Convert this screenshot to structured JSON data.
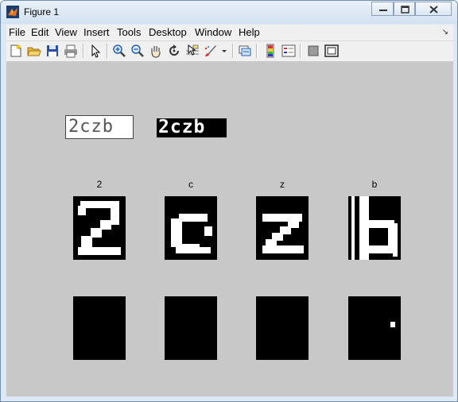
{
  "window": {
    "title": "Figure 1"
  },
  "menu": [
    "File",
    "Edit",
    "View",
    "Insert",
    "Tools",
    "Desktop",
    "Window",
    "Help"
  ],
  "toolbar": [
    "new-figure-icon",
    "open-icon",
    "save-icon",
    "print-icon",
    "pointer-icon",
    "zoom-in-icon",
    "zoom-out-icon",
    "pan-icon",
    "rotate-icon",
    "data-cursor-icon",
    "brush-icon",
    "brush-dropdown-icon",
    "link-icon",
    "colorbar-icon",
    "legend-icon",
    "hide-tools-icon",
    "show-tools-icon"
  ],
  "figure": {
    "captcha_text": "2czb",
    "binary_text": "2czb",
    "chars": [
      {
        "label": "2"
      },
      {
        "label": "c"
      },
      {
        "label": "z"
      },
      {
        "label": "b"
      }
    ]
  }
}
